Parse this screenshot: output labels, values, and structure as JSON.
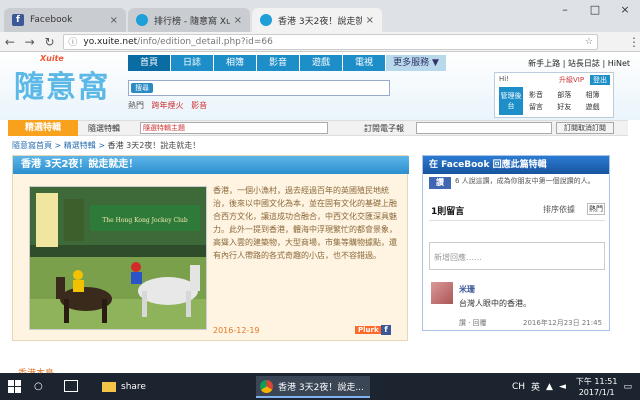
{
  "browser": {
    "tabs": [
      {
        "title": "Facebook",
        "icon": "facebook-icon"
      },
      {
        "title": "排行榜 - 隨意窩 Xuite遊",
        "icon": "xuite-icon"
      },
      {
        "title": "香港 3天2夜！說走就走",
        "icon": "xuite-icon"
      }
    ],
    "url_prefix": "yo.xuite.net",
    "url_rest": "/info/edition_detail.php?id=66"
  },
  "site": {
    "logo_text": "隨意窩",
    "logo_sub": "Xuite",
    "nav": [
      "首頁",
      "日誌",
      "相簿",
      "影音",
      "遊戲",
      "電視",
      "更多服務 ▼"
    ],
    "search_btn": "搜尋",
    "tags_label": "熱門",
    "tags": [
      "跨年煙火",
      "影音"
    ],
    "top_links": "新手上路 | 站長日誌 | HiNet",
    "user": {
      "hi": "Hi!",
      "vip": "升級VIP",
      "logout": "登出",
      "mgmt": "管理後台",
      "links": [
        "影音",
        "部落",
        "相簿",
        "留言",
        "好友",
        "遊戲"
      ]
    }
  },
  "goldbar": {
    "label": "精選特輯",
    "item1": "隨選特輯",
    "select_value": "隨選特輯主題",
    "item2": "訂閱電子報",
    "button": "訂閱取消訂閱"
  },
  "breadcrumb": {
    "path": "隨意窩首頁 > 精選特輯 > ",
    "current": "香港 3天2夜！說走就走！"
  },
  "article": {
    "title": "香港 3天2夜！說走就走！",
    "body": "香港，一個小漁村，過去經過百年的英國殖民地統治，後來以中國文化為本，並在固有文化的基礎上融合西方文化，讓這成功合融合，中西文化交匯深具魅力。此外一提到香港，體海中浮現繁忙的都會景象，高聳入雲的建築物，大型商場，市集等購物據點，還有內行人帶路的各式奇趣的小店，也不容錯過。",
    "date": "2016-12-19",
    "plurk": "Plurk",
    "photo_sign": "The Hong Kong Jockey Club"
  },
  "facebook": {
    "header": "在 FaceBook 回應此篇特輯",
    "like_btn": "讚",
    "likes_text": "6 人說這讚，成為你朋友中第一個說讚的人。",
    "count": "1則留言",
    "sort_label": "排序依據",
    "sort_btn": "熱門",
    "placeholder": "新增回應……",
    "comment_user": "米珊",
    "comment_text": "台灣人眼中的香港。",
    "comment_actions": "讚 · 回覆",
    "comment_date": "2016年12月23日 21:45"
  },
  "page_bottom_label": "香港本島",
  "taskbar": {
    "app1": "share",
    "app2": "香港 3天2夜！說走...",
    "ime1": "CH",
    "ime2": "英",
    "time": "下午 11:51",
    "date": "2017/1/1"
  }
}
